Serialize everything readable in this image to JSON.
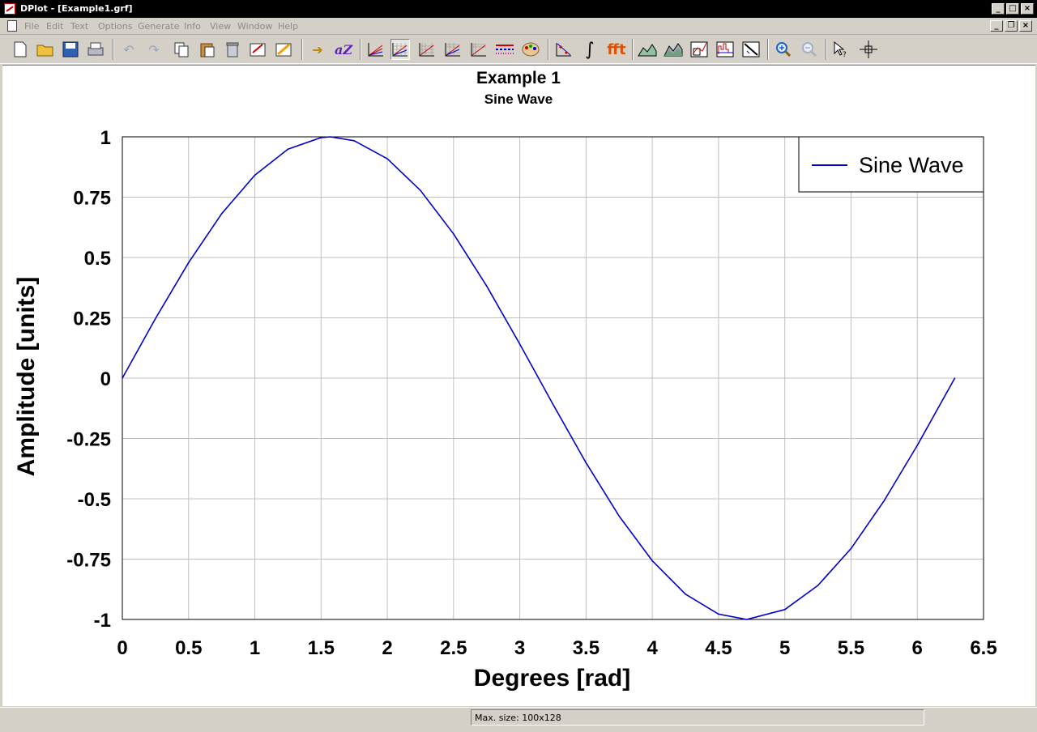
{
  "window": {
    "title": "DPlot - [Example1.grf]"
  },
  "menu": {
    "items": [
      "File",
      "Edit",
      "Text",
      "Options",
      "Generate",
      "Info",
      "View",
      "Window",
      "Help"
    ]
  },
  "toolbar": {
    "icons": [
      "new-file-icon",
      "open-folder-icon",
      "save-disk-icon",
      "print-icon",
      "undo-icon",
      "redo-icon",
      "copy-icon",
      "paste-icon",
      "trash-icon",
      "edit-data-icon",
      "edit-graph-icon",
      "arrow-insert-icon",
      "font-icon",
      "linear-scale-icon",
      "grid-scale-icon",
      "log-x-icon",
      "log-y-icon",
      "log-log-icon",
      "dashed-lines-icon",
      "palette-icon",
      "curve-points-icon",
      "integral-icon",
      "fft-icon",
      "area-fill-icon",
      "area-fill-alt-icon",
      "inset-icon",
      "histogram-icon",
      "trend-icon",
      "zoom-in-icon",
      "zoom-out-icon",
      "pointer-help-icon",
      "crosshair-icon"
    ],
    "integral_glyph": "∫",
    "fft_text": "fft",
    "font_text": "aZ"
  },
  "chart_data": {
    "type": "line",
    "title": "Example 1",
    "subtitle": "Sine Wave",
    "xlabel": "Degrees [rad]",
    "ylabel": "Amplitude [units]",
    "xlim": [
      0,
      6.5
    ],
    "ylim": [
      -1,
      1
    ],
    "xticks": [
      "0",
      "0.5",
      "1",
      "1.5",
      "2",
      "2.5",
      "3",
      "3.5",
      "4",
      "4.5",
      "5",
      "5.5",
      "6",
      "6.5"
    ],
    "yticks": [
      "1",
      "0.75",
      "0.5",
      "0.25",
      "0",
      "-0.25",
      "-0.5",
      "-0.75",
      "-1"
    ],
    "grid": true,
    "legend": "top-right",
    "series": [
      {
        "name": "Sine Wave",
        "color": "#0000cc",
        "x": [
          0,
          0.25,
          0.5,
          0.75,
          1,
          1.25,
          1.5,
          1.5708,
          1.75,
          2,
          2.25,
          2.5,
          2.75,
          3,
          3.1416,
          3.25,
          3.5,
          3.75,
          4,
          4.25,
          4.5,
          4.7124,
          5,
          5.25,
          5.5,
          5.75,
          6,
          6.2832
        ],
        "y": [
          0,
          0.247,
          0.479,
          0.682,
          0.841,
          0.949,
          0.997,
          1,
          0.984,
          0.909,
          0.778,
          0.598,
          0.382,
          0.141,
          0,
          -0.108,
          -0.351,
          -0.572,
          -0.757,
          -0.895,
          -0.978,
          -1,
          -0.959,
          -0.859,
          -0.706,
          -0.508,
          -0.279,
          0
        ]
      }
    ]
  },
  "status": {
    "text": "Max. size: 100x128"
  }
}
